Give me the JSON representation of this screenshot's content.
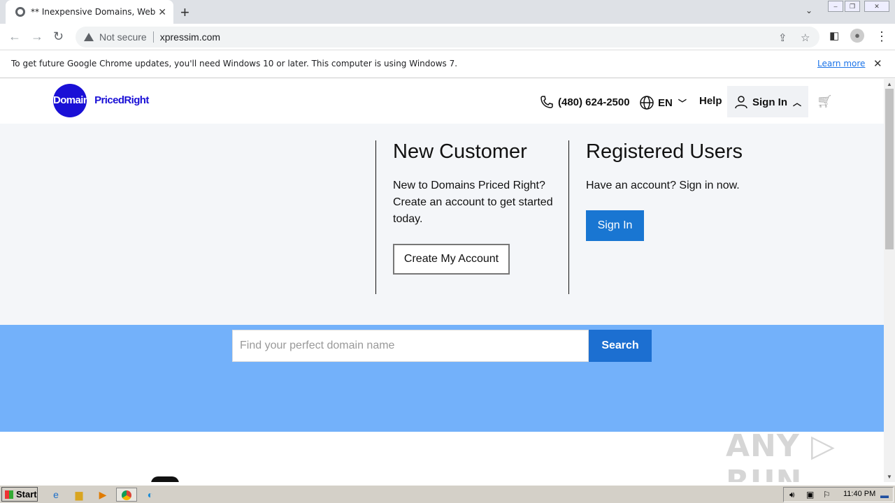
{
  "browser": {
    "tab_title": "** Inexpensive Domains, Web Hosti",
    "new_tab": "+",
    "tab_search": "⌄",
    "url": "xpressim.com",
    "security": "Not secure",
    "infobar_message": "To get future Google Chrome updates, you'll need Windows 10 or later. This computer is using Windows 7.",
    "infobar_link": "Learn more",
    "close": "✕"
  },
  "site": {
    "logo": {
      "part1": "Domains",
      "part2": "PricedRight"
    },
    "phone": "(480) 624-2500",
    "language": "EN",
    "help": "Help",
    "sign_in": "Sign In",
    "new_customer": {
      "title": "New Customer",
      "text": "New to Domains Priced Right? Create an account to get started today.",
      "button": "Create My Account"
    },
    "registered": {
      "title": "Registered Users",
      "text": "Have an account? Sign in now.",
      "button": "Sign In"
    },
    "search": {
      "placeholder": "Find your perfect domain name",
      "button": "Search"
    },
    "watermark": "ANY ▷ RUN"
  },
  "taskbar": {
    "start": "Start",
    "clock": "11:40 PM"
  },
  "colors": {
    "brand": "#1a10d6",
    "accent_blue": "#1976d2",
    "band": "#73b1fa"
  }
}
